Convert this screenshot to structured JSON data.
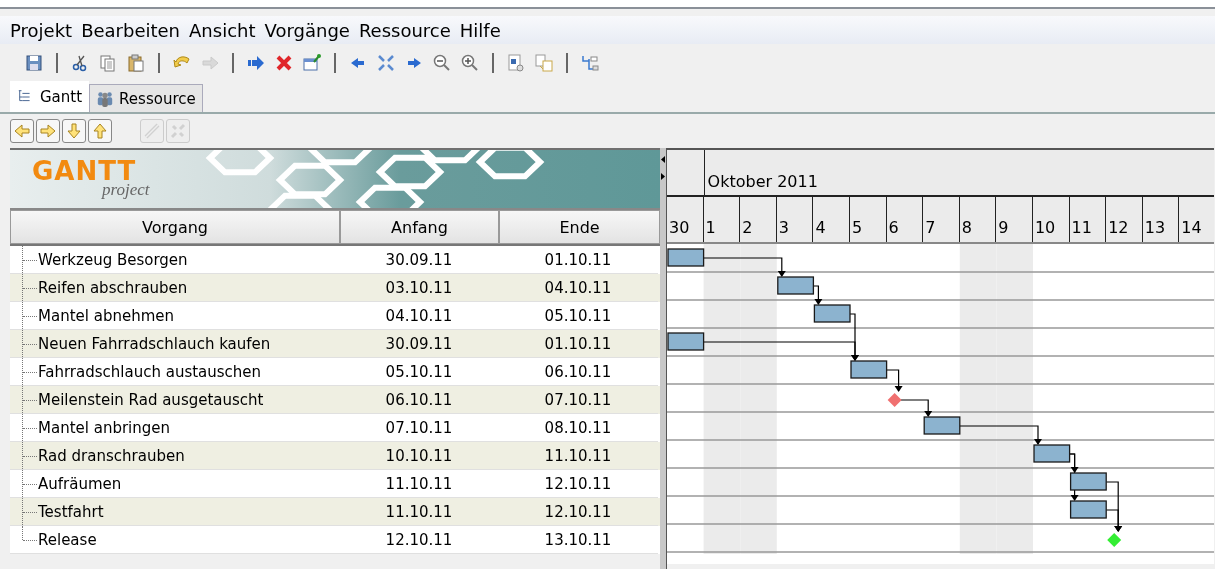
{
  "menu": [
    "Projekt",
    "Bearbeiten",
    "Ansicht",
    "Vorgänge",
    "Ressource",
    "Hilfe"
  ],
  "toolbar": [
    {
      "disabled": false
    },
    {
      "disabled": false
    },
    {
      "disabled": false
    },
    {
      "disabled": false
    },
    {
      "disabled": false
    },
    {
      "disabled": true
    },
    {
      "disabled": false
    },
    {
      "disabled": false
    },
    {
      "disabled": false
    },
    {
      "disabled": false
    },
    {
      "disabled": false
    },
    {
      "disabled": false
    },
    {
      "disabled": false
    },
    {
      "disabled": false
    },
    {
      "disabled": false
    },
    {
      "disabled": false
    },
    {
      "disabled": false
    }
  ],
  "tabs": [
    {
      "label": "Gantt",
      "selected": true
    },
    {
      "label": "Ressource",
      "selected": false
    }
  ],
  "task_toolbar": [
    {
      "disabled": false
    },
    {
      "disabled": false
    },
    {
      "disabled": false
    },
    {
      "disabled": false
    },
    {
      "disabled": true
    },
    {
      "disabled": true
    }
  ],
  "logo": {
    "title": "GANTT",
    "subtitle": "project"
  },
  "table": {
    "columns": [
      "Vorgang",
      "Anfang",
      "Ende"
    ],
    "rows": [
      {
        "name": "Werkzeug Besorgen",
        "start": "30.09.11",
        "end": "01.10.11",
        "kind": "task",
        "color": "#8cb3cf"
      },
      {
        "name": "Reifen abschrauben",
        "start": "03.10.11",
        "end": "04.10.11",
        "kind": "task",
        "color": "#8cb3cf",
        "link_from_previous": true
      },
      {
        "name": "Mantel abnehmen",
        "start": "04.10.11",
        "end": "05.10.11",
        "kind": "task",
        "color": "#8cb3cf",
        "link_from_previous": true,
        "link_from_second_previous": false
      },
      {
        "name": "Neuen Fahrradschlauch kaufen",
        "start": "30.09.11",
        "end": "01.10.11",
        "kind": "task",
        "color": "#8cb3cf",
        "link_from_previous": false,
        "link_from_second_previous": false
      },
      {
        "name": "Fahrradschlauch austauschen",
        "start": "05.10.11",
        "end": "06.10.11",
        "kind": "task",
        "color": "#8cb3cf",
        "link_from_previous": true,
        "link_from_second_previous": true
      },
      {
        "name": "Meilenstein Rad ausgetauscht",
        "start": "06.10.11",
        "end": "07.10.11",
        "kind": "milestone",
        "color": "#f07070",
        "link_from_previous": true,
        "link_from_second_previous": false
      },
      {
        "name": "Mantel anbringen",
        "start": "07.10.11",
        "end": "08.10.11",
        "kind": "task",
        "color": "#8cb3cf",
        "link_from_previous": true,
        "link_from_second_previous": false
      },
      {
        "name": "Rad dranschrauben",
        "start": "10.10.11",
        "end": "11.10.11",
        "kind": "task",
        "color": "#8cb3cf",
        "link_from_previous": true,
        "link_from_second_previous": false
      },
      {
        "name": "Aufräumen",
        "start": "11.10.11",
        "end": "12.10.11",
        "kind": "task",
        "color": "#8cb3cf",
        "link_from_previous": true,
        "link_from_second_previous": false
      },
      {
        "name": "Testfahrt",
        "start": "11.10.11",
        "end": "12.10.11",
        "kind": "task",
        "color": "#8cb3cf",
        "link_from_previous": false,
        "link_from_second_previous": true
      },
      {
        "name": "Release",
        "start": "12.10.11",
        "end": "13.10.11",
        "kind": "milestone",
        "color": "#33ee33",
        "link_from_previous": true,
        "link_from_second_previous": true
      }
    ]
  },
  "timeline": {
    "months": [
      "Oktober 2011"
    ],
    "days": [
      "30",
      "1",
      "2",
      "3",
      "4",
      "5",
      "6",
      "7",
      "8",
      "9",
      "10",
      "11",
      "12",
      "13",
      "14"
    ]
  }
}
